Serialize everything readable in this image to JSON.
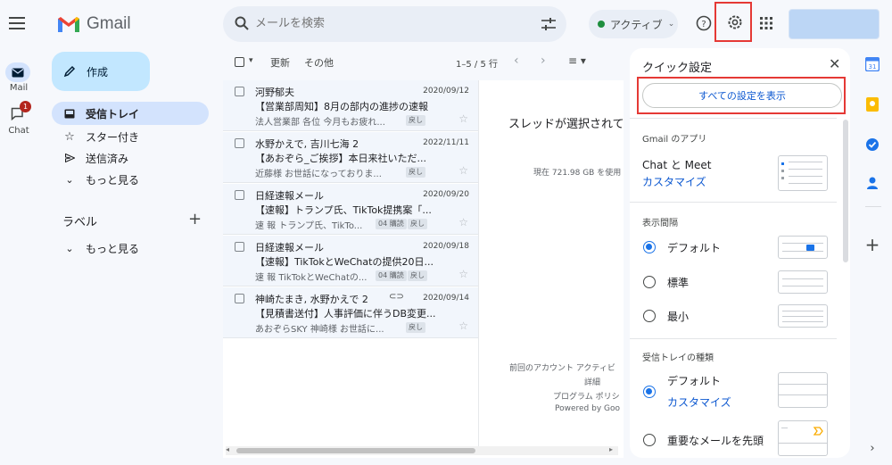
{
  "app": {
    "name": "Gmail"
  },
  "search": {
    "placeholder": "メールを検索"
  },
  "status": {
    "label": "アクティブ"
  },
  "rail": {
    "mail": "Mail",
    "chat": "Chat",
    "chat_badge": "1"
  },
  "compose": {
    "label": "作成"
  },
  "nav": {
    "items": [
      {
        "label": "受信トレイ",
        "icon": "inbox-icon",
        "active": true
      },
      {
        "label": "スター付き",
        "icon": "star-icon"
      },
      {
        "label": "送信済み",
        "icon": "send-icon"
      },
      {
        "label": "もっと見る",
        "icon": "chevron-down-icon"
      }
    ],
    "labels_heading": "ラベル",
    "labels_more": "もっと見る"
  },
  "toolbar": {
    "refresh": "更新",
    "more": "その他",
    "range": "1–5 / 5 行"
  },
  "emails": [
    {
      "from": "河野郁夫",
      "date": "2020/09/12",
      "subject": "【営業部周知】8月の部内の進捗の速報",
      "snippet": "法人営業部 各位 今月もお疲れ...",
      "tags": [
        "戻し"
      ]
    },
    {
      "from": "水野かえで, 吉川七海 2",
      "date": "2022/11/11",
      "subject": "【あおぞら_ご挨拶】本日来社いただ...",
      "snippet": "近藤様 お世話になっておりま...",
      "tags": [
        "戻し"
      ]
    },
    {
      "from": "日経速報メール",
      "date": "2020/09/20",
      "subject": "【速報】トランプ氏、TikTok提携案「...",
      "snippet": "速 報 トランプ氏、TikTo...",
      "tags": [
        "04 購読",
        "戻し"
      ]
    },
    {
      "from": "日経速報メール",
      "date": "2020/09/18",
      "subject": "【速報】TikTokとWeChatの提供20日...",
      "snippet": "速 報 TikTokとWeChatの...",
      "tags": [
        "04 購読",
        "戻し"
      ]
    },
    {
      "from": "神崎たまき, 水野かえで 2",
      "date": "2020/09/14",
      "subject": "【見積書送付】人事評価に伴うDB変更...",
      "snippet": "あおぞらSKY 神崎様 お世話に...",
      "tags": [
        "戻し"
      ],
      "attachment": true
    }
  ],
  "reading": {
    "no_selection": "スレッドが選択されて",
    "storage": "現在 721.98 GB を使用",
    "footer": [
      "前回のアカウント アクティビ",
      "詳細",
      "プログラム ポリシ",
      "Powered by Goo"
    ]
  },
  "quick_settings": {
    "title": "クイック設定",
    "all_settings": "すべての設定を表示",
    "apps_heading": "Gmail のアプリ",
    "apps_label": "Chat と Meet",
    "apps_customize": "カスタマイズ",
    "density_heading": "表示間隔",
    "density_options": [
      "デフォルト",
      "標準",
      "最小"
    ],
    "inbox_heading": "受信トレイの種類",
    "inbox_default": "デフォルト",
    "inbox_customize": "カスタマイズ",
    "inbox_important": "重要なメールを先頭"
  }
}
